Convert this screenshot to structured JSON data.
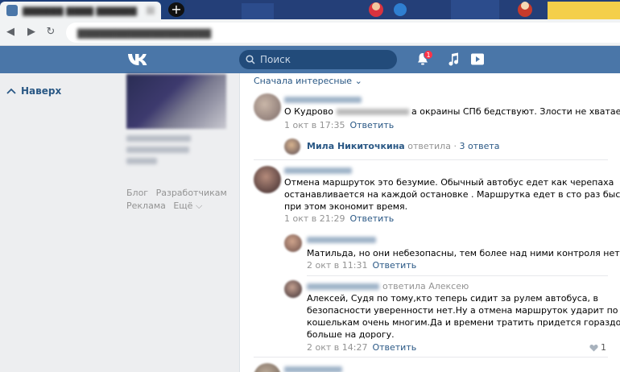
{
  "header": {
    "search_placeholder": "Поиск",
    "notification_count": "1"
  },
  "sidebar": {
    "up_label": "Наверх"
  },
  "footer": {
    "blog": "Блог",
    "developers": "Разработчикам",
    "ads": "Реклама",
    "more": "Ещё"
  },
  "feed": {
    "sort_label": "Сначала интересные",
    "comments": [
      {
        "text": "О Кудрово",
        "text_tail": "а окраины СПб бедствуют. Злости не хватает.",
        "date": "1 окт в 17:35",
        "reply_label": "Ответить",
        "thread": {
          "name": "Мила Никиточкина",
          "action": "ответила",
          "count": "3 ответа"
        }
      },
      {
        "lines": [
          "Отмена маршруток это безумие. Обычный автобус едет как черепаха",
          "останавливается на каждой остановке . Маршрутка едет в сто раз быстрее",
          "при этом экономит время."
        ],
        "date": "1 окт в 21:29",
        "reply_label": "Ответить"
      },
      {
        "text": "Матильда, но они небезопасны, тем более над ними контроля нет",
        "date": "2 окт в 11:31",
        "reply_label": "Ответить"
      },
      {
        "reply_to": "ответила Алексею",
        "lines": [
          "Алексей, Судя по тому,кто теперь сидит за рулем автобуса, в",
          "безопасности уверенности нет.Ну а отмена маршруток ударит по",
          "кошелькам очень многим.Да и времени тратить придется гораздо",
          "больше на дорогу."
        ],
        "date": "2 окт в 14:27",
        "reply_label": "Ответить",
        "likes": "1"
      }
    ]
  },
  "colors": {
    "header": "#4a76a8",
    "link": "#2a5885",
    "meta": "#939393",
    "badge": "#ff3347"
  }
}
